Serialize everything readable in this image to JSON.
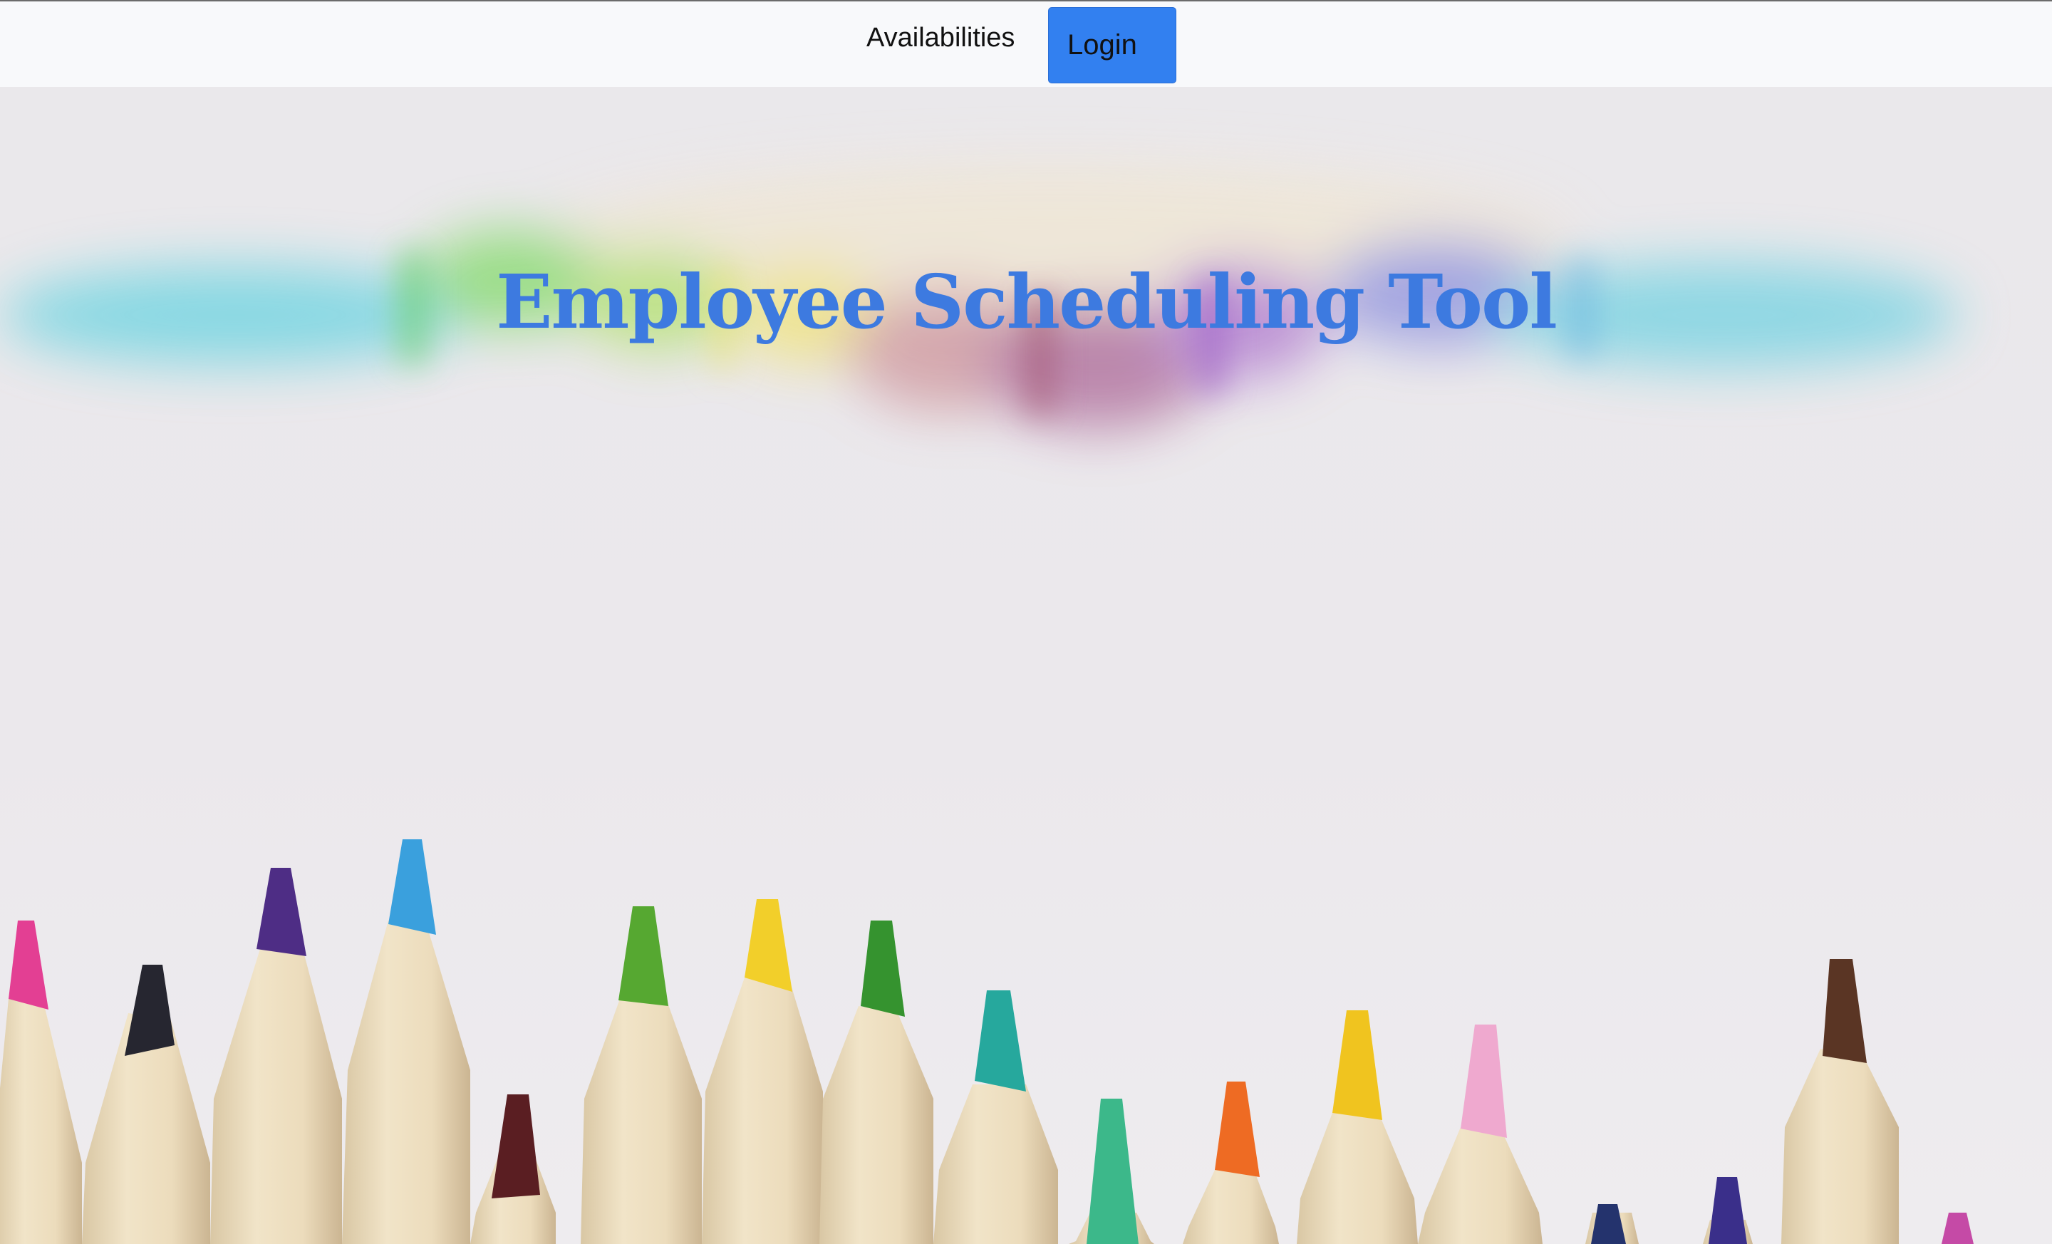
{
  "nav": {
    "availabilities_label": "Availabilities",
    "login_label": "Login"
  },
  "hero": {
    "title": "Employee Scheduling Tool",
    "background_description_icon": "colored-pencils-image"
  },
  "colors": {
    "navbar_bg": "#f8f9fb",
    "login_button_bg": "#3280f0",
    "title_color": "#3d7ae0",
    "hero_bg": "#e9e7ea"
  }
}
